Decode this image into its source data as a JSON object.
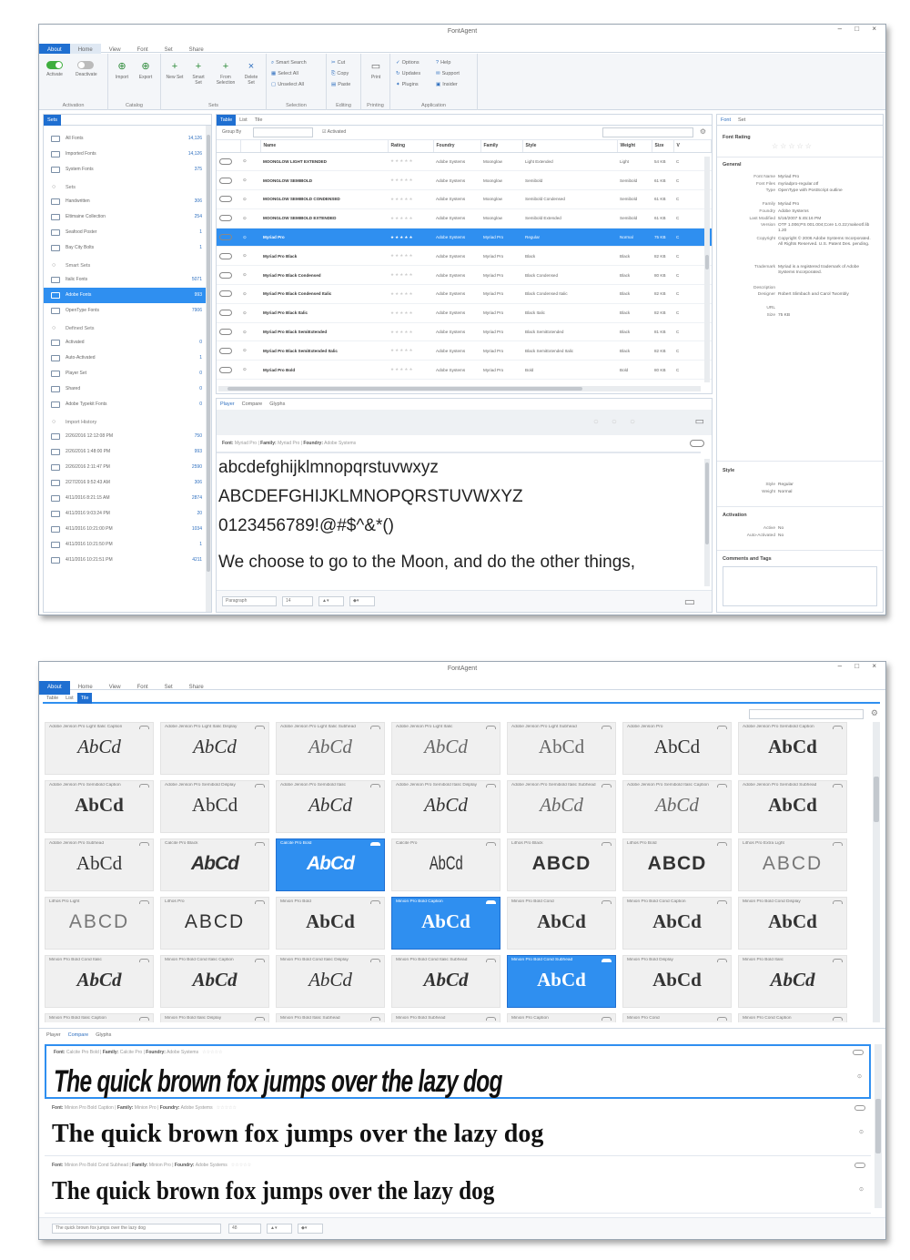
{
  "app_title": "FontAgent",
  "window_buttons": "– □ ×",
  "w1": {
    "menu": [
      "About",
      "Home",
      "View",
      "Font",
      "Set",
      "Share"
    ],
    "ribbon": {
      "groups": [
        "Activation",
        "Catalog",
        "Sets",
        "Selection",
        "Editing",
        "Printing",
        "Application"
      ],
      "buttons": [
        "Activate",
        "Deactivate",
        "Import",
        "Export",
        "New Set",
        "Smart Set",
        "From Selection",
        "Delete Set"
      ],
      "selection": [
        "Smart Search",
        "Select All",
        "Unselect All"
      ],
      "editing": [
        "Cut",
        "Copy",
        "Paste"
      ],
      "printing": "Print",
      "application": [
        "Options",
        "Help",
        "Updates",
        "Support",
        "Plugins",
        "Insider"
      ]
    },
    "sidebar": {
      "tabs": [
        "Sets"
      ],
      "library": [
        {
          "label": "All Fonts",
          "count": "14,126"
        },
        {
          "label": "Imported Fonts",
          "count": "14,126"
        },
        {
          "label": "System Fonts",
          "count": "375"
        }
      ],
      "sets_header": "Sets",
      "sets": [
        {
          "label": "Handwritten",
          "count": "306"
        },
        {
          "label": "Eltimaine Collection",
          "count": "254"
        },
        {
          "label": "Seafood Poster",
          "count": "1"
        },
        {
          "label": "Bay City Bolts",
          "count": "1"
        }
      ],
      "smart_header": "Smart Sets",
      "smart": [
        {
          "label": "Italic Fonts",
          "count": "5071"
        },
        {
          "label": "Adobe Fonts",
          "count": "993"
        },
        {
          "label": "OpenType Fonts",
          "count": "7906"
        }
      ],
      "defined_header": "Defined Sets",
      "defined": [
        {
          "label": "Activated",
          "count": "0"
        },
        {
          "label": "Auto-Activated",
          "count": "1"
        },
        {
          "label": "Player Set",
          "count": "0"
        },
        {
          "label": "Shared",
          "count": "0"
        },
        {
          "label": "Adobe Typekit Fonts",
          "count": "0"
        }
      ],
      "import_header": "Import History",
      "imports": [
        {
          "label": "2/26/2016 12:12:08 PM",
          "count": "750"
        },
        {
          "label": "2/26/2016 1:48:00 PM",
          "count": "993"
        },
        {
          "label": "2/26/2016 2:11:47 PM",
          "count": "2590"
        },
        {
          "label": "2/27/2016 9:52:43 AM",
          "count": "306"
        },
        {
          "label": "4/11/2016 8:21:15 AM",
          "count": "2874"
        },
        {
          "label": "4/11/2016 9:03:24 PM",
          "count": "20"
        },
        {
          "label": "4/11/2016 10:21:00 PM",
          "count": "1034"
        },
        {
          "label": "4/11/2016 10:21:50 PM",
          "count": "1"
        },
        {
          "label": "4/11/2016 10:21:51 PM",
          "count": "4211"
        }
      ]
    },
    "list": {
      "tabs": [
        "Table",
        "List",
        "Tile"
      ],
      "group_by": "Group By",
      "activated_label": "Activated",
      "columns": [
        "",
        "",
        "Name",
        "Rating",
        "Foundry",
        "Family",
        "Style",
        "Weight",
        "Size",
        "V"
      ],
      "rows": [
        {
          "name": "MOONGLOW LIGHT EXTENDED",
          "foundry": "Adobe Systems",
          "family": "Moonglow",
          "style": "Light Extended",
          "weight": "Light",
          "size": "54 KB"
        },
        {
          "name": "MOONGLOW SEMIBOLD",
          "foundry": "Adobe Systems",
          "family": "Moonglow",
          "style": "Semibold",
          "weight": "Semibold",
          "size": "61 KB"
        },
        {
          "name": "MOONGLOW SEMIBOLD CONDENSED",
          "foundry": "Adobe Systems",
          "family": "Moonglow",
          "style": "Semibold Condensed",
          "weight": "Semibold",
          "size": "61 KB"
        },
        {
          "name": "MOONGLOW SEMIBOLD EXTENDED",
          "foundry": "Adobe Systems",
          "family": "Moonglow",
          "style": "Semibold Extended",
          "weight": "Semibold",
          "size": "61 KB"
        },
        {
          "name": "Myriad Pro",
          "foundry": "Adobe Systems",
          "family": "Myriad Pro",
          "style": "Regular",
          "weight": "Normal",
          "size": "75 KB"
        },
        {
          "name": "Myriad Pro Black",
          "foundry": "Adobe Systems",
          "family": "Myriad Pro",
          "style": "Black",
          "weight": "Black",
          "size": "82 KB"
        },
        {
          "name": "Myriad Pro Black Condensed",
          "foundry": "Adobe Systems",
          "family": "Myriad Pro",
          "style": "Black Condensed",
          "weight": "Black",
          "size": "80 KB"
        },
        {
          "name": "Myriad Pro Black Condensed Italic",
          "foundry": "Adobe Systems",
          "family": "Myriad Pro",
          "style": "Black Condensed Italic",
          "weight": "Black",
          "size": "82 KB"
        },
        {
          "name": "Myriad Pro Black Italic",
          "foundry": "Adobe Systems",
          "family": "Myriad Pro",
          "style": "Black Italic",
          "weight": "Black",
          "size": "82 KB"
        },
        {
          "name": "Myriad Pro Black SemiExtended",
          "foundry": "Adobe Systems",
          "family": "Myriad Pro",
          "style": "Black SemiExtended",
          "weight": "Black",
          "size": "81 KB"
        },
        {
          "name": "Myriad Pro Black SemiExtended Italic",
          "foundry": "Adobe Systems",
          "family": "Myriad Pro",
          "style": "Black SemiExtended Italic",
          "weight": "Black",
          "size": "82 KB"
        },
        {
          "name": "Myriad Pro Bold",
          "foundry": "Adobe Systems",
          "family": "Myriad Pro",
          "style": "Bold",
          "weight": "Bold",
          "size": "80 KB"
        }
      ]
    },
    "player": {
      "tabs": [
        "Player",
        "Compare",
        "Glyphs"
      ],
      "font_label": "Font:",
      "font_value": "Myriad Pro",
      "family_label": "Family:",
      "family_value": "Myriad Pro",
      "foundry_label": "Foundry:",
      "foundry_value": "Adobe Systems",
      "lines": [
        "abcdefghijklmnopqrstuvwxyz",
        "ABCDEFGHIJKLMNOPQRSTUVWXYZ",
        "0123456789!@#$^&*()",
        "We choose to go to the Moon, and do the other things,"
      ],
      "mode": "Paragraph",
      "size": "14"
    },
    "details": {
      "tabs": [
        "Font",
        "Set"
      ],
      "rating_title": "Font Rating",
      "general_title": "General",
      "props": [
        [
          "Font Name",
          "Myriad Pro"
        ],
        [
          "Font Files",
          "myriadpro-regular.otf"
        ],
        [
          "Type",
          "OpenType with PostScript outline"
        ],
        [
          "Family",
          "Myriad Pro"
        ],
        [
          "Foundry",
          "Adobe Systems"
        ],
        [
          "Last Modified",
          "5/16/2007 5:45:16 PM"
        ],
        [
          "Version",
          "OTF 1.006;PS 001.004;Core 1.0.22;makeotf.lib 1.20"
        ],
        [
          "Copyright",
          "Copyright © 2006 Adobe Systems Incorporated. All Rights Reserved. U.S. Patent Des. pending."
        ],
        [
          "Trademark",
          "Myriad is a registered trademark of Adobe Systems Incorporated."
        ],
        [
          "Description",
          ""
        ],
        [
          "Designer",
          "Robert Slimbach and Carol Twombly"
        ],
        [
          "URL",
          ""
        ],
        [
          "Size",
          "75 KB"
        ]
      ],
      "style_title": "Style",
      "style_props": [
        [
          "Style",
          "Regular"
        ],
        [
          "Weight",
          "Normal"
        ]
      ],
      "activation_title": "Activation",
      "activation_props": [
        [
          "Active",
          "No"
        ],
        [
          "Auto-Activated",
          "No"
        ]
      ],
      "comments_title": "Comments and Tags"
    }
  },
  "w2": {
    "menu": [
      "About",
      "Home",
      "View",
      "Font",
      "Set",
      "Share"
    ],
    "view_tabs": [
      "Table",
      "List",
      "Tile"
    ],
    "tiles": [
      {
        "label": "Adobe Jenson Pro Light Italic Caption",
        "sample": "AbCd",
        "style": "italic"
      },
      {
        "label": "Adobe Jenson Pro Light Italic Display",
        "sample": "AbCd",
        "style": "italic"
      },
      {
        "label": "Adobe Jenson Pro Light Italic Subhead",
        "sample": "AbCd",
        "style": "italic-light"
      },
      {
        "label": "Adobe Jenson Pro Light Italic",
        "sample": "AbCd",
        "style": "italic-light"
      },
      {
        "label": "Adobe Jenson Pro Light Subhead",
        "sample": "AbCd",
        "style": "light"
      },
      {
        "label": "Adobe Jenson Pro",
        "sample": "AbCd",
        "style": "normal"
      },
      {
        "label": "Adobe Jenson Pro Semibold Caption",
        "sample": "AbCd",
        "style": "semibold"
      },
      {
        "label": "Adobe Jenson Pro Semibold Caption",
        "sample": "AbCd",
        "style": "semibold"
      },
      {
        "label": "Adobe Jenson Pro Semibold Display",
        "sample": "AbCd",
        "style": "normal"
      },
      {
        "label": "Adobe Jenson Pro Semibold Italic",
        "sample": "AbCd",
        "style": "italic"
      },
      {
        "label": "Adobe Jenson Pro Semibold Italic Display",
        "sample": "AbCd",
        "style": "italic"
      },
      {
        "label": "Adobe Jenson Pro Semibold Italic Subhead",
        "sample": "AbCd",
        "style": "italic-light"
      },
      {
        "label": "Adobe Jenson Pro Semibold Italic Caption",
        "sample": "AbCd",
        "style": "italic-light"
      },
      {
        "label": "Adobe Jenson Pro Semibold Subhead",
        "sample": "AbCd",
        "style": "semibold"
      },
      {
        "label": "Adobe Jenson Pro Subhead",
        "sample": "AbCd",
        "style": "normal"
      },
      {
        "label": "Calcite Pro Black",
        "sample": "AbCd",
        "style": "black"
      },
      {
        "label": "Calcite Pro Bold",
        "sample": "AbCd",
        "style": "black",
        "selected": true
      },
      {
        "label": "Calcite Pro",
        "sample": "AbCd",
        "style": "condensed"
      },
      {
        "label": "Lithos Pro Black",
        "sample": "ABCD",
        "style": "caps-black"
      },
      {
        "label": "Lithos Pro Bold",
        "sample": "ABCD",
        "style": "caps-black"
      },
      {
        "label": "Lithos Pro Extra Light",
        "sample": "ABCD",
        "style": "caps-light"
      },
      {
        "label": "Lithos Pro Light",
        "sample": "ABCD",
        "style": "caps-light"
      },
      {
        "label": "Lithos Pro",
        "sample": "ABCD",
        "style": "caps"
      },
      {
        "label": "Minion Pro Bold",
        "sample": "AbCd",
        "style": "semibold"
      },
      {
        "label": "Minion Pro Bold Caption",
        "sample": "AbCd",
        "style": "semibold",
        "selected": true
      },
      {
        "label": "Minion Pro Bold Cond",
        "sample": "AbCd",
        "style": "semibold"
      },
      {
        "label": "Minion Pro Bold Cond Caption",
        "sample": "AbCd",
        "style": "semibold"
      },
      {
        "label": "Minion Pro Bold Cond Display",
        "sample": "AbCd",
        "style": "semibold"
      },
      {
        "label": "Minion Pro Bold Cond Italic",
        "sample": "AbCd",
        "style": "bold-italic"
      },
      {
        "label": "Minion Pro Bold Cond Italic Caption",
        "sample": "AbCd",
        "style": "bold-italic"
      },
      {
        "label": "Minion Pro Bold Cond Italic Display",
        "sample": "AbCd",
        "style": "italic"
      },
      {
        "label": "Minion Pro Bold Cond Italic Subhead",
        "sample": "AbCd",
        "style": "bold-italic"
      },
      {
        "label": "Minion Pro Bold Cond Subhead",
        "sample": "AbCd",
        "style": "semibold",
        "selected": true
      },
      {
        "label": "Minion Pro Bold Display",
        "sample": "AbCd",
        "style": "semibold"
      },
      {
        "label": "Minion Pro Bold Italic",
        "sample": "AbCd",
        "style": "bold-italic"
      }
    ],
    "tiles_partial": [
      "Minion Pro Bold Italic Caption",
      "Minion Pro Bold Italic Display",
      "Minion Pro Bold Italic Subhead",
      "Minion Pro Bold Subhead",
      "Minion Pro Caption",
      "Minion Pro Cond",
      "Minion Pro Cond Caption"
    ],
    "bottom_tabs": [
      "Player",
      "Compare",
      "Glyphs"
    ],
    "compare": [
      {
        "font": "Calcite Pro Bold",
        "family": "Calcite Pro",
        "foundry": "Adobe Systems",
        "text": "The quick brown fox jumps over the lazy dog",
        "style": "calcite",
        "selected": true
      },
      {
        "font": "Minion Pro Bold Caption",
        "family": "Minion Pro",
        "foundry": "Adobe Systems",
        "text": "The quick brown fox jumps over the lazy dog",
        "style": "minion-bold"
      },
      {
        "font": "Minion Pro Bold Cond Subhead",
        "family": "Minion Pro",
        "foundry": "Adobe Systems",
        "text": "The quick brown fox jumps over the lazy dog",
        "style": "minion-cond"
      }
    ],
    "labels": {
      "font": "Font:",
      "family": "Family:",
      "foundry": "Foundry:"
    },
    "input_text": "The quick brown fox jumps over the lazy dog",
    "size": "48"
  }
}
